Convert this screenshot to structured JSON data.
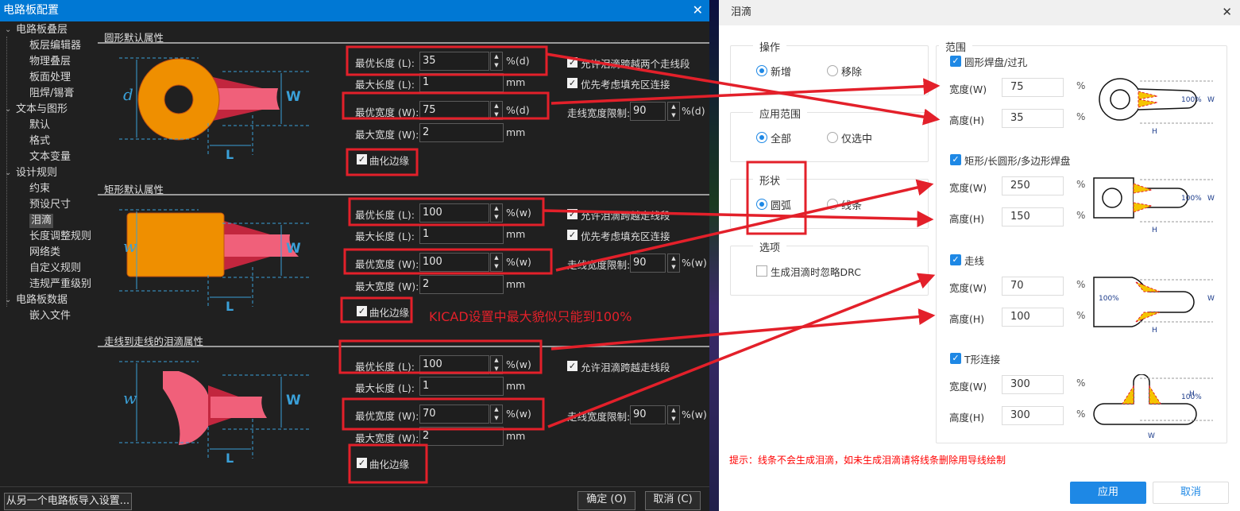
{
  "left_dialog": {
    "title": "电路板配置",
    "close": "✕",
    "tree": [
      {
        "label": "电路板叠层",
        "level": 0
      },
      {
        "label": "板层编辑器",
        "level": 1
      },
      {
        "label": "物理叠层",
        "level": 1
      },
      {
        "label": "板面处理",
        "level": 1
      },
      {
        "label": "阻焊/锡膏",
        "level": 1
      },
      {
        "label": "文本与图形",
        "level": 0
      },
      {
        "label": "默认",
        "level": 1
      },
      {
        "label": "格式",
        "level": 1
      },
      {
        "label": "文本变量",
        "level": 1
      },
      {
        "label": "设计规则",
        "level": 0
      },
      {
        "label": "约束",
        "level": 1
      },
      {
        "label": "预设尺寸",
        "level": 1
      },
      {
        "label": "泪滴",
        "level": 1,
        "selected": true
      },
      {
        "label": "长度调整规则",
        "level": 1
      },
      {
        "label": "网络类",
        "level": 1
      },
      {
        "label": "自定义规则",
        "level": 1
      },
      {
        "label": "违规严重级别",
        "level": 1
      },
      {
        "label": "电路板数据",
        "level": 0
      },
      {
        "label": "嵌入文件",
        "level": 1
      }
    ],
    "sections": [
      {
        "title": "圆形默认属性",
        "diagram_labels": {
          "d": "d",
          "W": "W",
          "L": "L"
        },
        "best_length_label": "最优长度 (L):",
        "best_length": "35",
        "best_length_unit": "%(d)",
        "max_length_label": "最大长度 (L):",
        "max_length": "1",
        "max_length_unit": "mm",
        "best_width_label": "最优宽度 (W):",
        "best_width": "75",
        "best_width_unit": "%(d)",
        "max_width_label": "最大宽度 (W):",
        "max_width": "2",
        "max_width_unit": "mm",
        "curve_label": "曲化边缘",
        "curve_checked": true,
        "options": [
          {
            "label": "允许泪滴跨越两个走线段",
            "checked": true
          },
          {
            "label": "优先考虑填充区连接",
            "checked": true
          }
        ],
        "limit_label": "走线宽度限制:",
        "limit": "90",
        "limit_unit": "%(d)"
      },
      {
        "title": "矩形默认属性",
        "diagram_labels": {
          "d": "w",
          "W": "W",
          "L": "L"
        },
        "best_length_label": "最优长度 (L):",
        "best_length": "100",
        "best_length_unit": "%(w)",
        "max_length_label": "最大长度 (L):",
        "max_length": "1",
        "max_length_unit": "mm",
        "best_width_label": "最优宽度 (W):",
        "best_width": "100",
        "best_width_unit": "%(w)",
        "max_width_label": "最大宽度 (W):",
        "max_width": "2",
        "max_width_unit": "mm",
        "curve_label": "曲化边缘",
        "curve_checked": true,
        "options": [
          {
            "label": "允许泪滴跨越走线段",
            "checked": true
          },
          {
            "label": "优先考虑填充区连接",
            "checked": true
          }
        ],
        "limit_label": "走线宽度限制:",
        "limit": "90",
        "limit_unit": "%(w)"
      },
      {
        "title": "走线到走线的泪滴属性",
        "diagram_labels": {
          "d": "w",
          "W": "W",
          "L": "L"
        },
        "best_length_label": "最优长度 (L):",
        "best_length": "100",
        "best_length_unit": "%(w)",
        "max_length_label": "最大长度 (L):",
        "max_length": "1",
        "max_length_unit": "mm",
        "best_width_label": "最优宽度 (W):",
        "best_width": "70",
        "best_width_unit": "%(w)",
        "max_width_label": "最大宽度 (W):",
        "max_width": "2",
        "max_width_unit": "mm",
        "curve_label": "曲化边缘",
        "curve_checked": true,
        "options": [
          {
            "label": "允许泪滴跨越走线段",
            "checked": true
          }
        ],
        "limit_label": "走线宽度限制:",
        "limit": "90",
        "limit_unit": "%(w)"
      }
    ],
    "import_button": "从另一个电路板导入设置...",
    "ok_button": "确定 (O)",
    "cancel_button": "取消 (C)"
  },
  "annotation": {
    "note": "KICAD设置中最大貌似只能到100%",
    "color": "#e3202a"
  },
  "right_dialog": {
    "title": "泪滴",
    "close": "✕",
    "operation": {
      "title": "操作",
      "options": [
        "新增",
        "移除"
      ],
      "selected": 0
    },
    "apply_scope": {
      "title": "应用范围",
      "options": [
        "全部",
        "仅选中"
      ],
      "selected": 0
    },
    "shape": {
      "title": "形状",
      "options": [
        "圆弧",
        "线条"
      ],
      "selected": 0
    },
    "options": {
      "title": "选项",
      "ignore_drc_label": "生成泪滴时忽略DRC",
      "ignore_drc": false
    },
    "scope": {
      "title": "范围",
      "width_label": "宽度(W)",
      "height_label": "高度(H)",
      "unit": "%",
      "items": [
        {
          "label": "圆形焊盘/过孔",
          "checked": true,
          "width": "75",
          "height": "35",
          "fig": {
            "w": "W",
            "p": "100%",
            "h": "H"
          }
        },
        {
          "label": "矩形/长圆形/多边形焊盘",
          "checked": true,
          "width": "250",
          "height": "150",
          "fig": {
            "w": "W",
            "p": "100%",
            "h": "H"
          }
        },
        {
          "label": "走线",
          "checked": true,
          "width": "70",
          "height": "100",
          "fig": {
            "w": "W",
            "p": "100%",
            "h": "H"
          }
        },
        {
          "label": "T形连接",
          "checked": true,
          "width": "300",
          "height": "300",
          "fig": {
            "w": "W",
            "p": "100%",
            "h": "H"
          }
        }
      ]
    },
    "hint": "提示：线条不会生成泪滴，如未生成泪滴请将线条删除用导线绘制",
    "apply_button": "应用",
    "cancel_button": "取消",
    "accent": "#1e88e5"
  }
}
